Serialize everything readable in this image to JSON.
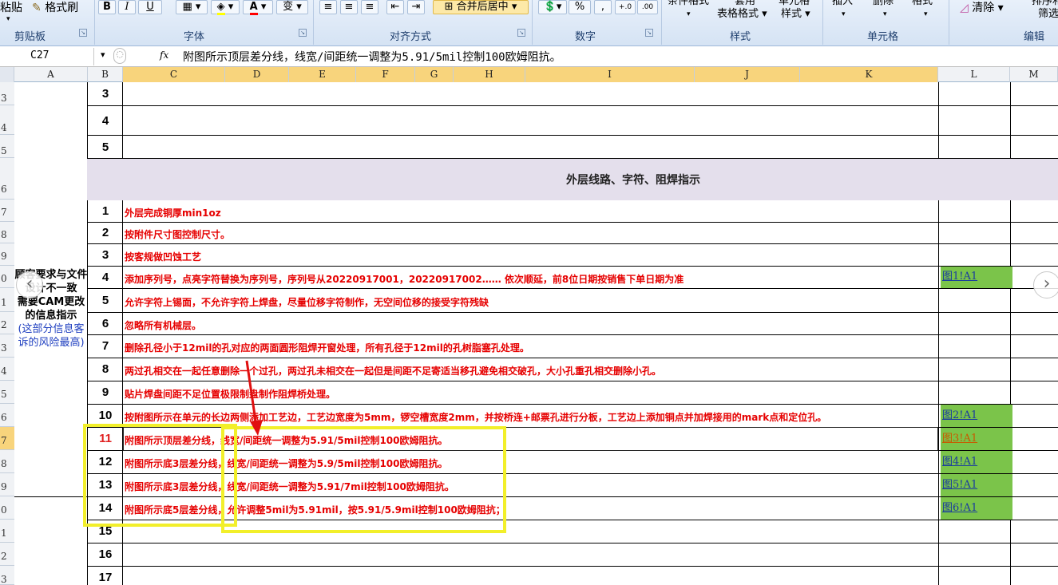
{
  "ribbon": {
    "paste_label": "粘贴",
    "format_painter_label": "格式刷",
    "bold": "B",
    "italic": "I",
    "underline": "U",
    "merge_center_label": "合并后居中",
    "percent": "%",
    "comma": ",",
    "dec_inc": "+.0",
    "dec_dec": ".00",
    "conditional_format_label": "条件格式",
    "table_label": "套用",
    "table_format_label": "表格格式",
    "cell_style_label": "单元格",
    "cell_style_sub_label": "样式",
    "insert_label": "插入",
    "delete_label": "删除",
    "format_label": "格式",
    "clear_label": "清除",
    "sort_label": "排序和",
    "filter_label": "筛选",
    "groups": {
      "clipboard": "剪贴板",
      "font": "字体",
      "alignment": "对齐方式",
      "number": "数字",
      "styles": "样式",
      "cells": "单元格",
      "editing": "编辑"
    }
  },
  "formula_bar": {
    "cell_ref": "C27",
    "fx": "fx",
    "formula": "附图所示顶层差分线，线宽/间距统一调整为5.91/5mil控制100欧姆阻抗。"
  },
  "columns": [
    "A",
    "B",
    "C",
    "D",
    "E",
    "F",
    "G",
    "H",
    "I",
    "J",
    "K",
    "L",
    "M"
  ],
  "row_headers": [
    "3",
    "4",
    "5",
    "6",
    "7",
    "8",
    "9",
    "0",
    "1",
    "2",
    "3",
    "4",
    "5",
    "6",
    "7",
    "8",
    "9",
    "0",
    "1",
    "2",
    "3"
  ],
  "upper_numbers": [
    "3",
    "4",
    "5"
  ],
  "banner": "外层线路、字符、阻焊指示",
  "merged_cell": {
    "part1": "顾客要求与文件设计不一致",
    "part2": "需要CAM更改的信息指示",
    "part3": "(这部分信息客诉的风险最高)"
  },
  "rows": [
    {
      "n": "1",
      "text": "外层完成铜厚min1oz"
    },
    {
      "n": "2",
      "text": "按附件尺寸图控制尺寸。"
    },
    {
      "n": "3",
      "text": "按客规做凹蚀工艺"
    },
    {
      "n": "4",
      "text": "添加序列号，点亮字符替换为序列号，序列号从20220917001，20220917002…… 依次顺延，前8位日期按销售下单日期为准",
      "link": "图1!A1"
    },
    {
      "n": "5",
      "text": "允许字符上锡面，不允许字符上焊盘，尽量位移字符制作，无空间位移的接受字符残缺"
    },
    {
      "n": "6",
      "text": "忽略所有机械层。"
    },
    {
      "n": "7",
      "text": "删除孔径小于12mil的孔对应的两面圆形阻焊开窗处理，所有孔径于12mil的孔树脂塞孔处理。"
    },
    {
      "n": "8",
      "text": "两过孔相交在一起任意删除一个过孔，两过孔未相交在一起但是间距不足寄适当移孔避免相交破孔，大小孔重孔相交删除小孔。"
    },
    {
      "n": "9",
      "text": "贴片焊盘间距不足位置极限制盘制作阻焊桥处理。"
    },
    {
      "n": "10",
      "text": "按附图所示在单元的长边两侧添加工艺边，工艺边宽度为5mm，锣空槽宽度2mm，并按桥连+邮票孔进行分板，工艺边上添加铜点并加焊接用的mark点和定位孔。",
      "link": "图2!A1"
    },
    {
      "n": "11",
      "text": "附图所示顶层差分线，线宽/间距统一调整为5.91/5mil控制100欧姆阻抗。",
      "link": "图3!A1"
    },
    {
      "n": "12",
      "text": "附图所示底3层差分线，线宽/间距统一调整为5.9/5mil控制100欧姆阻抗。",
      "link": "图4!A1"
    },
    {
      "n": "13",
      "text": "附图所示底3层差分线，线宽/间距统一调整为5.91/7mil控制100欧姆阻抗。",
      "link": "图5!A1"
    },
    {
      "n": "14",
      "text": "附图所示底5层差分线，允许调整5mil为5.91mil，按5.91/5.9mil控制100欧姆阻抗；",
      "link": "图6!A1"
    },
    {
      "n": "15",
      "text": ""
    },
    {
      "n": "16",
      "text": ""
    },
    {
      "n": "17",
      "text": ""
    }
  ],
  "colors": {
    "accent_red": "#e60000",
    "link_fill": "#7bc44a",
    "banner_fill": "#e4dfec",
    "highlight_box": "#f2ef2a",
    "selected_header": "#f8d47c"
  }
}
